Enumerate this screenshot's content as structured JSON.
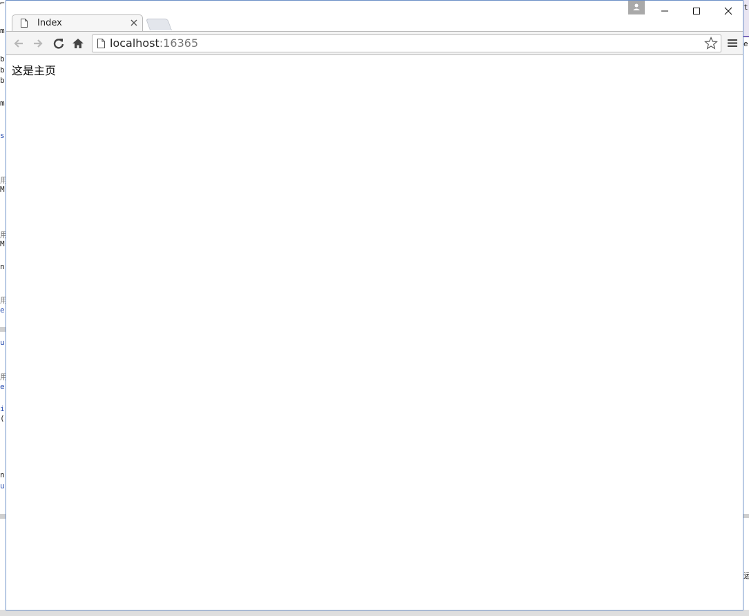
{
  "browser": {
    "tab": {
      "title": "Index",
      "icon": "document-icon"
    },
    "toolbar": {
      "back_icon": "back-arrow-icon",
      "forward_icon": "forward-arrow-icon",
      "reload_icon": "reload-icon",
      "home_icon": "home-icon",
      "menu_icon": "hamburger-menu-icon",
      "bookmark_icon": "star-icon"
    },
    "address": {
      "host": "localhost",
      "port": ":16365"
    },
    "window_controls": [
      "minimize",
      "maximize",
      "close"
    ]
  },
  "page": {
    "text": "这是主页"
  },
  "background_ide": {
    "left_gutter_chars": [
      "b",
      "b",
      "b",
      "m",
      "s",
      "用",
      "M",
      "用",
      "M",
      "n",
      "用",
      "e",
      "u",
      "用",
      "e",
      "i",
      "(",
      "n",
      "u"
    ],
    "right_gutter_chars": [
      "t",
      "e",
      "运"
    ]
  },
  "colors": {
    "window_border": "#6b8fc7",
    "toolbar_bg": "#f4f4f4",
    "port_gray": "#777777"
  }
}
